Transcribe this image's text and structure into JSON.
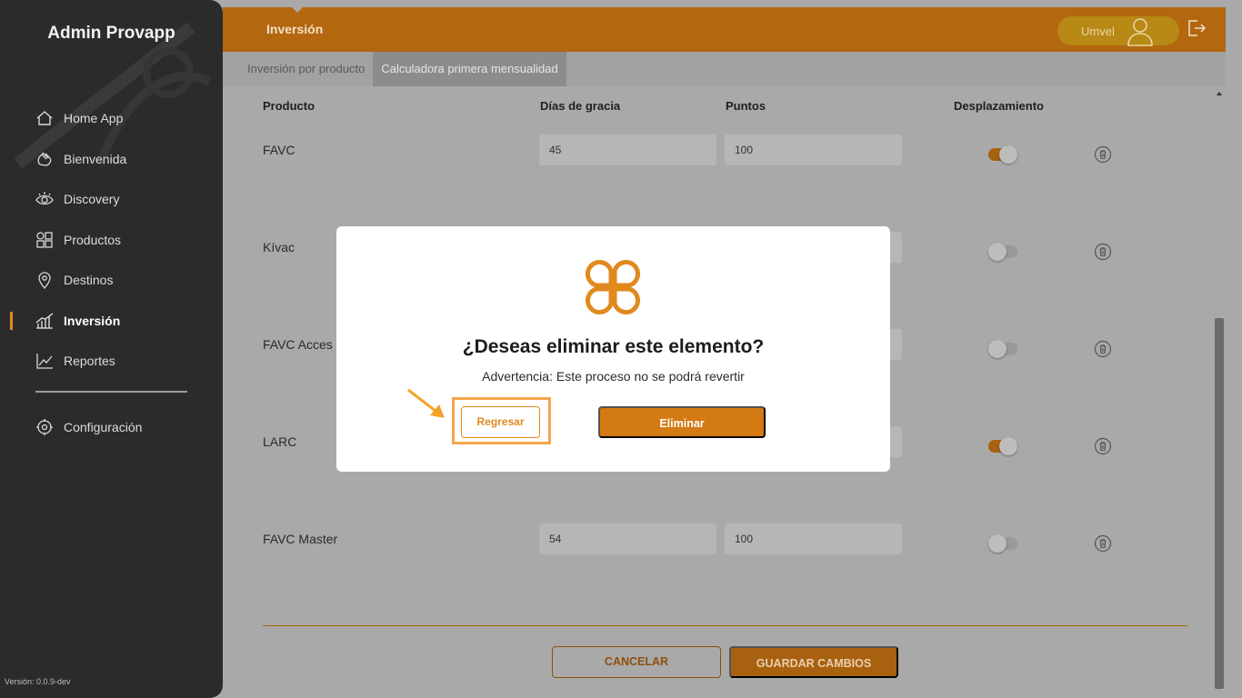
{
  "sidebar": {
    "brand": "Admin Provapp",
    "items": [
      {
        "label": "Home App",
        "icon": "home-icon"
      },
      {
        "label": "Bienvenida",
        "icon": "wave-hand-icon"
      },
      {
        "label": "Discovery",
        "icon": "eye-icon"
      },
      {
        "label": "Productos",
        "icon": "grid-icon"
      },
      {
        "label": "Destinos",
        "icon": "location-pin-icon"
      },
      {
        "label": "Inversión",
        "icon": "bar-chart-icon",
        "active": true
      },
      {
        "label": "Reportes",
        "icon": "line-chart-icon"
      }
    ],
    "config_label": "Configuración",
    "version": "Versión: 0.0.9-dev"
  },
  "header": {
    "title": "Inversión",
    "user_name": "Umvel"
  },
  "tabs": [
    {
      "label": "Inversión por producto"
    },
    {
      "label": "Calculadora primera mensualidad",
      "active": true
    }
  ],
  "table": {
    "columns": [
      "Producto",
      "Días de gracia",
      "Puntos",
      "Desplazamiento"
    ],
    "rows": [
      {
        "name": "FAVC",
        "grace": "45",
        "points": "100",
        "shift": true
      },
      {
        "name": "Kívac",
        "grace": "",
        "points": "",
        "shift": false
      },
      {
        "name": "FAVC Acces",
        "grace": "",
        "points": "",
        "shift": false
      },
      {
        "name": "LARC",
        "grace": "",
        "points": "",
        "shift": true
      },
      {
        "name": "FAVC Master",
        "grace": "54",
        "points": "100",
        "shift": false
      }
    ]
  },
  "actions": {
    "cancel": "CANCELAR",
    "save": "GUARDAR CAMBIOS"
  },
  "modal": {
    "title": "¿Deseas eliminar este elemento?",
    "message": "Advertencia: Este proceso no se podrá revertir",
    "back": "Regresar",
    "delete": "Eliminar"
  },
  "colors": {
    "accent": "#e08a1e",
    "header": "#b3670f",
    "sidebar": "#2b2b2b"
  }
}
